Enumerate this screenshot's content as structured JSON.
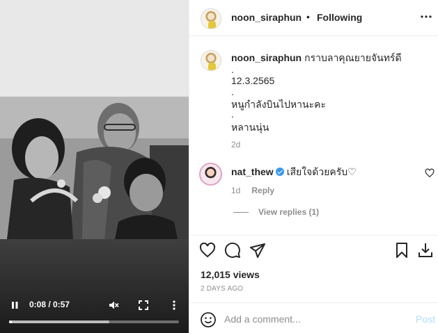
{
  "post": {
    "username": "noon_siraphun",
    "separator": "•",
    "follow_status": "Following",
    "caption": {
      "username": "noon_siraphun",
      "text": "กราบลาคุณยายจันทร์ดี",
      "lines": [
        ".",
        "12.3.2565",
        ".",
        "หนูกำลังบินไปหานะคะ",
        ".",
        "หลานนุ่น"
      ]
    },
    "caption_age": "2d",
    "views": "12,015 views",
    "posted": "2 DAYS AGO"
  },
  "comment": {
    "username": "nat_thew",
    "text": "เสียใจด้วยครับ♡",
    "age": "1d",
    "reply_label": "Reply",
    "view_replies": "View replies (1)"
  },
  "video": {
    "time": "0:08 / 0:57",
    "progress": 0.0,
    "buffered": 0.59
  },
  "add_comment": {
    "placeholder": "Add a comment...",
    "post_label": "Post"
  },
  "colors": {
    "accent": "#0095f6",
    "post_disabled": "#b3dbff",
    "muted": "#8e8e8e",
    "text": "#262626"
  },
  "icons": [
    "more-options-icon",
    "heart-icon",
    "comment-icon",
    "share-icon",
    "bookmark-icon",
    "download-icon",
    "emoji-icon",
    "pause-icon",
    "mute-icon",
    "fullscreen-icon",
    "video-more-icon",
    "verified-badge-icon"
  ]
}
